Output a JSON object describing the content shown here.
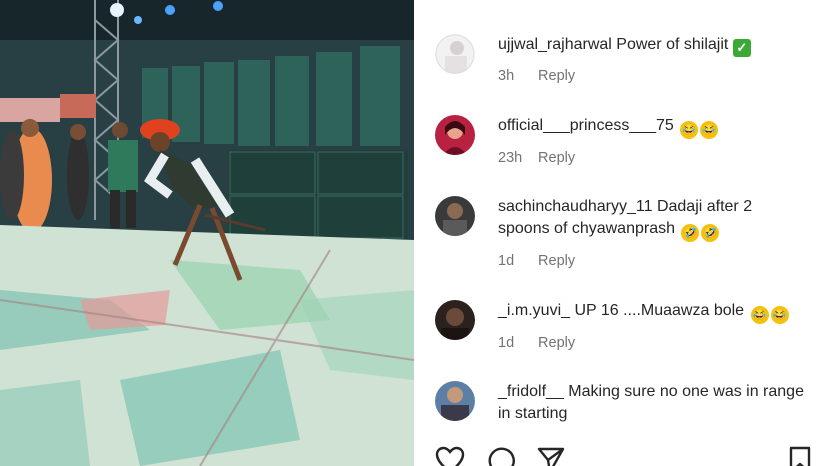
{
  "post": {
    "media_description_icon": "video-frame"
  },
  "comments": [
    {
      "user": "ujjwal_rajharwal",
      "text": "Power of shilajit",
      "suffix_icon": "check-mark-emoji",
      "time": "3h",
      "reply": "Reply"
    },
    {
      "user": "official___princess___75",
      "text": "",
      "emojis": [
        "😂",
        "😂"
      ],
      "time": "23h",
      "reply": "Reply"
    },
    {
      "user": "sachinchaudharyy_11",
      "text": "Dadaji after 2 spoons of chyawanprash",
      "emojis": [
        "🤣",
        "🤣"
      ],
      "time": "1d",
      "reply": "Reply"
    },
    {
      "user": "_i.m.yuvi_",
      "text": "UP 16 ....Muaawza bole",
      "emojis": [
        "😂",
        "😂"
      ],
      "time": "1d",
      "reply": "Reply"
    },
    {
      "user": "_fridolf__",
      "text": "Making sure no one was in range in starting",
      "time": "",
      "reply": ""
    }
  ],
  "actions": {
    "like_icon": "heart-icon",
    "comment_icon": "comment-icon",
    "share_icon": "send-icon",
    "save_icon": "bookmark-icon"
  },
  "colors": {
    "text": "#262626",
    "meta": "#737373"
  }
}
